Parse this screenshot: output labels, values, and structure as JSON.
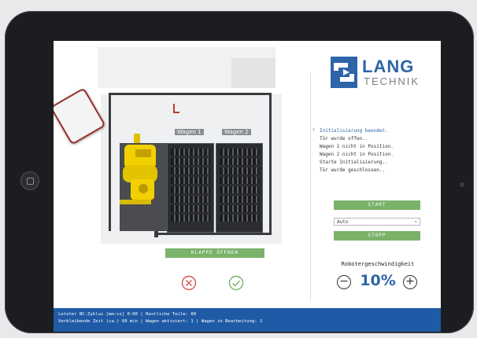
{
  "brand": {
    "lang": "LANG",
    "technik": "TECHNIK"
  },
  "cell": {
    "wagon1_label": "Wagen 1",
    "wagon2_label": "Wagen 2",
    "open_door_button": "KLAPPE ÖFFNEN"
  },
  "log": [
    "Initialisierung beendet.",
    "Tür wurde offen..",
    "Wagen 1 nicht in Position.",
    "Wagen 2 nicht in Position.",
    "Starte Initialisierung..",
    "Tür wurde geschlossen.."
  ],
  "controls": {
    "start_label": "START",
    "mode_value": "Auto",
    "stop_label": "STOPP",
    "speed_title": "Robotergeschwindigkeit",
    "speed_value": "10%",
    "minus": "−",
    "plus": "+"
  },
  "status": {
    "line1": "Letzter NC-Zyklus [mm:ss] 0:00 | Restliche Teile: 00",
    "line2": "Verbleibende Zeit (ca.) 60 min | Wagen aktiviert: 1 | Wagen in Bearbeitung: 1"
  },
  "colors": {
    "accent": "#1f5aa6",
    "green": "#7ab26a",
    "cancel": "#d9534f",
    "ok": "#7ab26a"
  }
}
